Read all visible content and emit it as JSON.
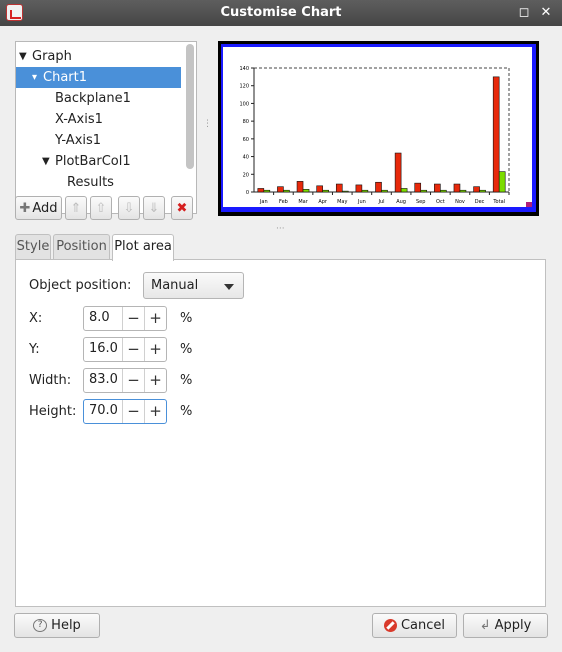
{
  "window": {
    "title": "Customise Chart",
    "maximize_glyph": "◻",
    "close_glyph": "✕"
  },
  "tree": {
    "items": [
      {
        "label": "Graph",
        "expander": "▼",
        "level": 0,
        "selected": false
      },
      {
        "label": "Chart1",
        "expander": "▾",
        "level": 1,
        "selected": true
      },
      {
        "label": "Backplane1",
        "expander": "",
        "level": 2,
        "selected": false
      },
      {
        "label": "X-Axis1",
        "expander": "",
        "level": 2,
        "selected": false
      },
      {
        "label": "Y-Axis1",
        "expander": "",
        "level": 2,
        "selected": false
      },
      {
        "label": "PlotBarCol1",
        "expander": "▼",
        "level": 2,
        "selected": false
      },
      {
        "label": "Results",
        "expander": "",
        "level": 3,
        "selected": false
      }
    ]
  },
  "toolbar": {
    "add_label": "Add",
    "add_glyph": "✚",
    "top_glyph": "⇑",
    "up_glyph": "⇧",
    "down_glyph": "⇩",
    "bottom_glyph": "⇓",
    "delete_glyph": "✖"
  },
  "tabs": [
    {
      "label": "Style",
      "active": false
    },
    {
      "label": "Position",
      "active": false
    },
    {
      "label": "Plot area",
      "active": true
    }
  ],
  "plot_area": {
    "object_position_label": "Object position:",
    "object_position_value": "Manual",
    "fields": [
      {
        "label": "X:",
        "value": "8.0",
        "unit": "%"
      },
      {
        "label": "Y:",
        "value": "16.0",
        "unit": "%"
      },
      {
        "label": "Width:",
        "value": "83.0",
        "unit": "%"
      },
      {
        "label": "Height:",
        "value": "70.0",
        "unit": "%"
      }
    ],
    "dec_glyph": "−",
    "inc_glyph": "+"
  },
  "buttons": {
    "help": "Help",
    "cancel": "Cancel",
    "apply": "Apply"
  },
  "colors": {
    "series1": "#e8290b",
    "series2": "#7cdc00",
    "selection": "#4a90d9",
    "preview_border": "#1a1aff"
  },
  "chart_data": {
    "type": "bar",
    "categories": [
      "Jan",
      "Feb",
      "Mar",
      "Apr",
      "May",
      "Jun",
      "Jul",
      "Aug",
      "Sep",
      "Oct",
      "Nov",
      "Dec",
      "Total"
    ],
    "series": [
      {
        "values": [
          4,
          6,
          12,
          7,
          9,
          8,
          11,
          44,
          10,
          9,
          9,
          6,
          130
        ]
      },
      {
        "values": [
          2,
          2,
          3,
          2,
          1,
          2,
          2,
          4,
          2,
          2,
          2,
          2,
          23
        ]
      }
    ],
    "yticks": [
      "0",
      "20",
      "40",
      "60",
      "80",
      "100",
      "120",
      "140"
    ],
    "ylim": [
      0,
      140
    ],
    "xlabel": "",
    "ylabel": "",
    "grid": false
  }
}
